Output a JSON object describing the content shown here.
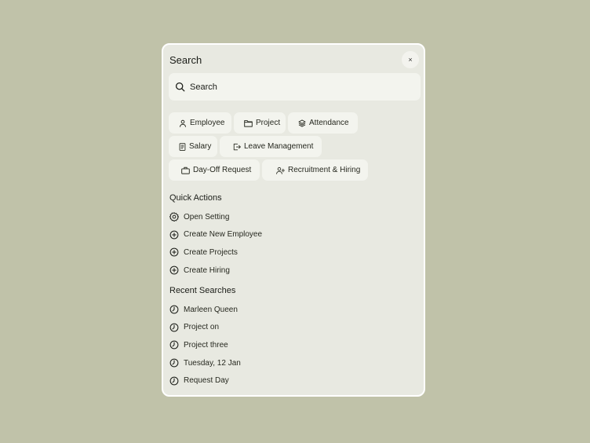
{
  "dialog": {
    "title": "Search",
    "close_label": "×"
  },
  "search": {
    "placeholder": "Search"
  },
  "filters": {
    "rows": [
      [
        {
          "label": "Employee",
          "icon": "user-icon"
        },
        {
          "label": "Project",
          "icon": "folder-icon"
        },
        {
          "label": "Attendance",
          "icon": "layers-icon"
        }
      ],
      [
        {
          "label": "Salary",
          "icon": "receipt-icon"
        },
        {
          "label": "Leave Management",
          "icon": "logout-icon"
        }
      ],
      [
        {
          "label": "Day-Off Request",
          "icon": "briefcase-icon"
        },
        {
          "label": "Recruitment & Hiring",
          "icon": "user-plus-icon"
        }
      ]
    ]
  },
  "quick_actions": {
    "title": "Quick Actions",
    "items": [
      {
        "label": "Open Setting",
        "icon": "gear-icon"
      },
      {
        "label": "Create New Employee",
        "icon": "plus-circle-icon"
      },
      {
        "label": "Create Projects",
        "icon": "plus-circle-icon"
      },
      {
        "label": "Create Hiring",
        "icon": "plus-circle-icon"
      }
    ]
  },
  "recent": {
    "title": "Recent Searches",
    "items": [
      {
        "label": "Marleen Queen",
        "icon": "clock-icon"
      },
      {
        "label": "Project on",
        "icon": "clock-icon"
      },
      {
        "label": "Project three",
        "icon": "clock-icon"
      },
      {
        "label": "Tuesday, 12 Jan",
        "icon": "clock-icon"
      },
      {
        "label": "Request Day",
        "icon": "clock-icon"
      }
    ]
  },
  "colors": {
    "background": "#c0c2a9",
    "panel": "#e8e9e1",
    "chip": "#f3f4ee",
    "text": "#1b1d18"
  }
}
